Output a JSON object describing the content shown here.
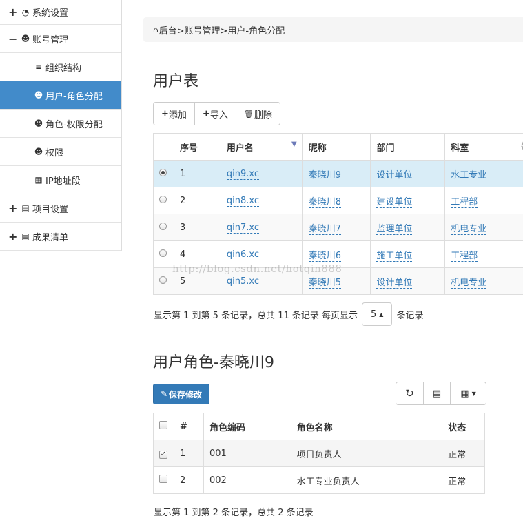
{
  "sidebar": {
    "items": [
      {
        "label": "系统设置",
        "toggle": "+",
        "icon": "dashboard-icon"
      },
      {
        "label": "账号管理",
        "toggle": "−",
        "icon": "users-icon"
      },
      {
        "label": "组织结构",
        "icon": "list-icon"
      },
      {
        "label": "用户-角色分配",
        "icon": "users-icon",
        "active": true
      },
      {
        "label": "角色-权限分配",
        "icon": "users-icon"
      },
      {
        "label": "权限",
        "icon": "users-icon"
      },
      {
        "label": "IP地址段",
        "icon": "grid-icon"
      },
      {
        "label": "项目设置",
        "toggle": "+",
        "icon": "list-alt-icon"
      },
      {
        "label": "成果清单",
        "toggle": "+",
        "icon": "list-alt-icon"
      }
    ]
  },
  "breadcrumb": {
    "text": "后台>账号管理>用户-角色分配"
  },
  "user_table": {
    "title": "用户表",
    "toolbar": {
      "add": "添加",
      "import": "导入",
      "delete": "删除"
    },
    "headers": [
      "序号",
      "用户名",
      "昵称",
      "部门",
      "科室"
    ],
    "rows": [
      {
        "no": "1",
        "username": "qin9.xc",
        "nickname": "秦晓川9",
        "dept": "设计单位",
        "section": "水工专业"
      },
      {
        "no": "2",
        "username": "qin8.xc",
        "nickname": "秦晓川8",
        "dept": "建设单位",
        "section": "工程部"
      },
      {
        "no": "3",
        "username": "qin7.xc",
        "nickname": "秦晓川7",
        "dept": "监理单位",
        "section": "机电专业"
      },
      {
        "no": "4",
        "username": "qin6.xc",
        "nickname": "秦晓川6",
        "dept": "施工单位",
        "section": "工程部"
      },
      {
        "no": "5",
        "username": "qin5.xc",
        "nickname": "秦晓川5",
        "dept": "设计单位",
        "section": "机电专业"
      }
    ],
    "page_info": "显示第 1 到第 5 条记录，总共 11 条记录 每页显示",
    "page_size": "5",
    "page_suffix": "条记录"
  },
  "role_table": {
    "title": "用户角色-秦晓川9",
    "save_label": "保存修改",
    "headers": [
      "#",
      "角色编码",
      "角色名称",
      "状态"
    ],
    "rows": [
      {
        "no": "1",
        "code": "001",
        "name": "项目负责人",
        "status": "正常",
        "checked": true
      },
      {
        "no": "2",
        "code": "002",
        "name": "水工专业负责人",
        "status": "正常",
        "checked": false
      }
    ],
    "page_info": "显示第 1 到第 2 条记录，总共 2 条记录"
  },
  "watermark": "http://blog.csdn.net/hotqin888"
}
